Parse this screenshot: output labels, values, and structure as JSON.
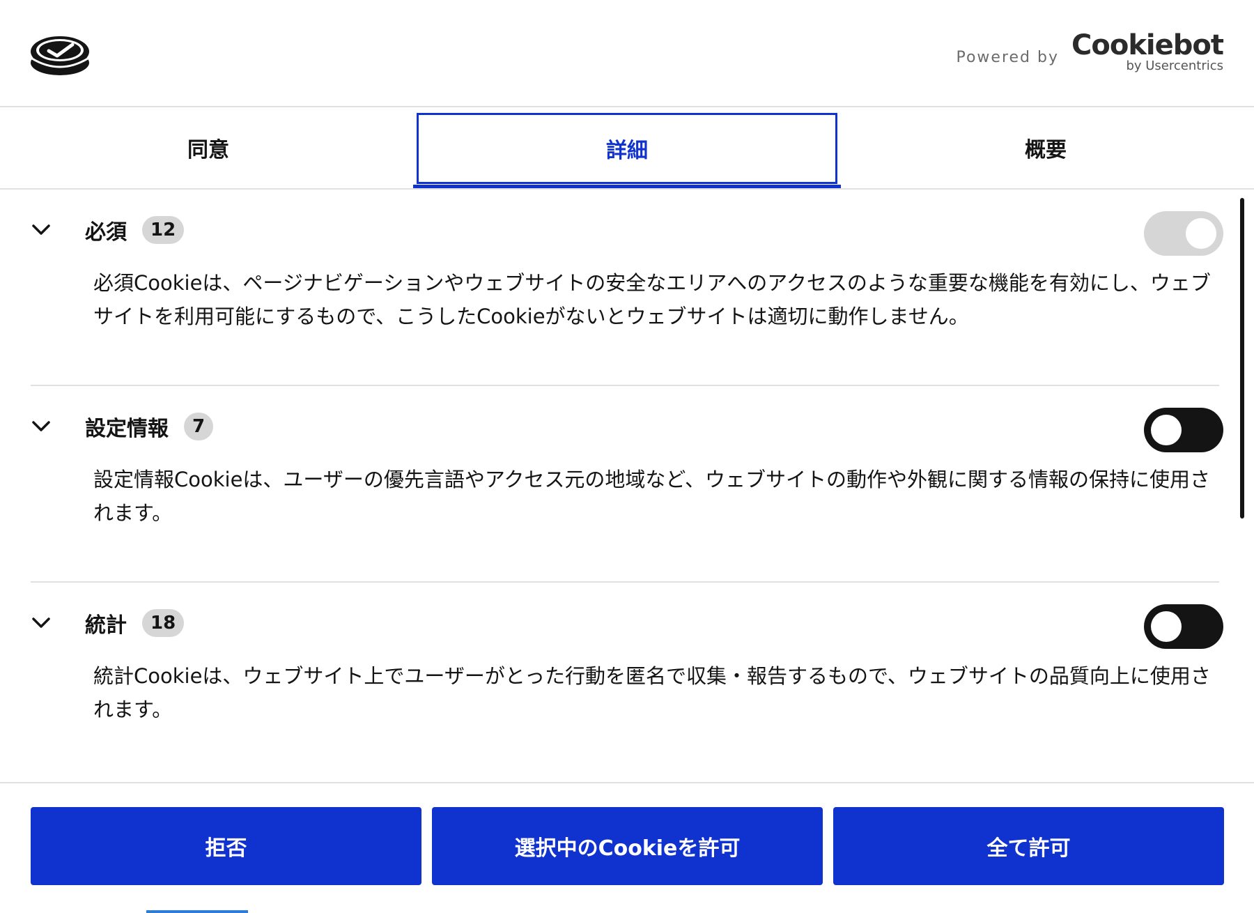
{
  "header": {
    "powered_by": "Powered by",
    "brand_name": "Cookiebot",
    "brand_sub": "by Usercentrics"
  },
  "tabs": [
    {
      "label": "同意",
      "active": false
    },
    {
      "label": "詳細",
      "active": true
    },
    {
      "label": "概要",
      "active": false
    }
  ],
  "sections": [
    {
      "title": "必須",
      "count": "12",
      "toggle": "on-disabled",
      "description": "必須Cookieは、ページナビゲーションやウェブサイトの安全なエリアへのアクセスのような重要な機能を有効にし、ウェブサイトを利用可能にするもので、こうしたCookieがないとウェブサイトは適切に動作しません。"
    },
    {
      "title": "設定情報",
      "count": "7",
      "toggle": "off",
      "description": "設定情報Cookieは、ユーザーの優先言語やアクセス元の地域など、ウェブサイトの動作や外観に関する情報の保持に使用されます。"
    },
    {
      "title": "統計",
      "count": "18",
      "toggle": "off",
      "description": "統計Cookieは、ウェブサイト上でユーザーがとった行動を匿名で収集・報告するもので、ウェブサイトの品質向上に使用されます。"
    }
  ],
  "footer": {
    "reject_label": "拒否",
    "allow_selected_label": "選択中のCookieを許可",
    "allow_all_label": "全て許可"
  },
  "colors": {
    "accent": "#1032cf",
    "text": "#141414",
    "divider": "#e0e0e0",
    "badge_bg": "#d6d6d6"
  }
}
